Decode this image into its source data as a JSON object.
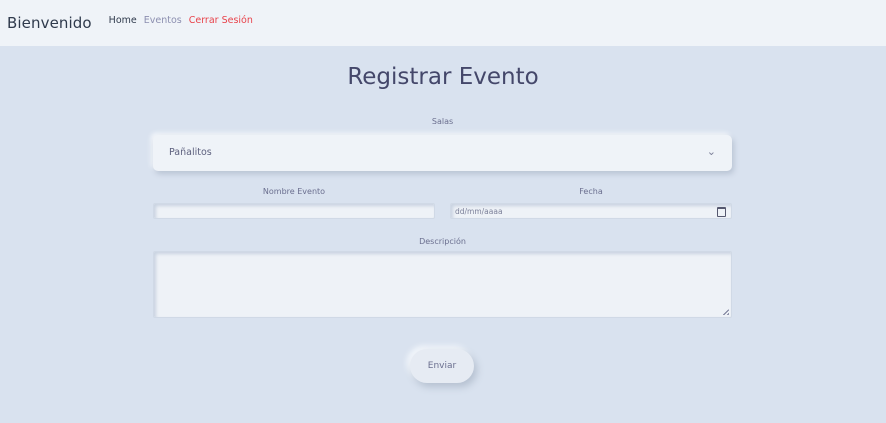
{
  "nav": {
    "brand": "Bienvenido",
    "links": [
      {
        "label": "Home",
        "color": "#2f3a4c"
      },
      {
        "label": "Eventos",
        "color": "#8c8fb0"
      },
      {
        "label": "Cerrar Sesión",
        "color": "#e8434b"
      }
    ]
  },
  "form": {
    "title": "Registrar Evento",
    "salas": {
      "label": "Salas",
      "selected": "Pañalitos",
      "icon": "chevron-down-icon"
    },
    "nombre_evento": {
      "label": "Nombre Evento",
      "value": ""
    },
    "fecha": {
      "label": "Fecha",
      "placeholder": "dd/mm/aaaa",
      "icon": "calendar-icon"
    },
    "descripcion": {
      "label": "Descripción",
      "value": ""
    },
    "submit_label": "Enviar"
  },
  "colors": {
    "page_bg": "#d9e2ef",
    "navbar_bg": "#eff3f8",
    "logout": "#e8434b"
  }
}
